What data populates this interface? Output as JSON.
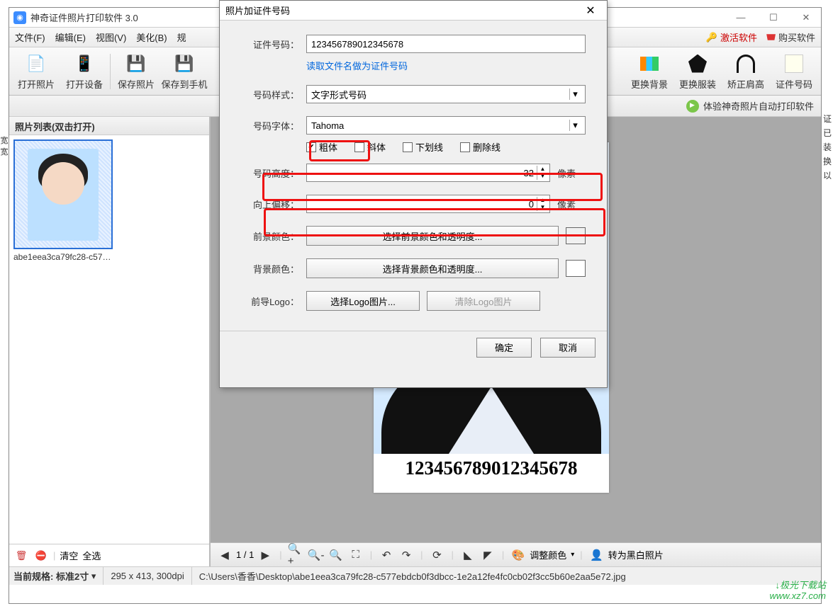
{
  "app": {
    "title": "神奇证件照片打印软件 3.0",
    "win_min": "—",
    "win_max": "☐",
    "win_close": "✕"
  },
  "menu": {
    "file": "文件(F)",
    "edit": "编辑(E)",
    "view": "视图(V)",
    "beautify": "美化(B)",
    "spec": "规",
    "activate": "激活软件",
    "buy": "购买软件"
  },
  "toolbar": {
    "open_photo": "打开照片",
    "open_device": "打开设备",
    "save_photo": "保存照片",
    "save_phone": "保存到手机",
    "change_bg": "更换背景",
    "change_clothes": "更换服装",
    "fix_shoulder": "矫正肩高",
    "id_number": "证件号码"
  },
  "promo": {
    "text": "体验神奇照片自动打印软件"
  },
  "left": {
    "header": "照片列表(双击打开)",
    "thumb_name": "abe1eea3ca79fc28-c577ebdcb0f...",
    "clear": "清空",
    "select_all": "全选"
  },
  "preview": {
    "caption": "123456789012345678"
  },
  "center_footer": {
    "page": "1 / 1",
    "adjust_color": "调整颜色",
    "to_bw": "转为黑白照片"
  },
  "status": {
    "spec_label": "当前规格:",
    "spec_value": "标准2寸",
    "dims": "295 x 413, 300dpi",
    "path": "C:\\Users\\香香\\Desktop\\abe1eea3ca79fc28-c577ebdcb0f3dbcc-1e2a12fe4fc0cb02f3cc5b60e2aa5e72.jpg"
  },
  "dialog": {
    "title": "照片加证件号码",
    "close": "✕",
    "lbl_id": "证件号码：",
    "val_id": "123456789012345678",
    "link_filename": "读取文件名做为证件号码",
    "lbl_style": "号码样式：",
    "val_style": "文字形式号码",
    "lbl_font": "号码字体：",
    "val_font": "Tahoma",
    "chk_bold": "粗体",
    "chk_italic": "斜体",
    "chk_underline": "下划线",
    "chk_strike": "删除线",
    "lbl_height": "号码高度：",
    "val_height": "32",
    "unit_px": "像素",
    "lbl_offset": "向上偏移：",
    "val_offset": "0",
    "lbl_fg": "前景颜色：",
    "btn_fg": "选择前景颜色和透明度...",
    "lbl_bg": "背景颜色：",
    "btn_bg": "选择背景颜色和透明度...",
    "lbl_logo": "前导Logo：",
    "btn_logo_sel": "选择Logo图片...",
    "btn_logo_clr": "清除Logo图片",
    "ok": "确定",
    "cancel": "取消",
    "colors": {
      "fg": "#000000",
      "bg": "#ffffff"
    }
  },
  "watermark": {
    "l1": "↓极光下载站",
    "l2": "www.xz7.com"
  },
  "side_text": {
    "right": "证已装换以",
    "left": "宽 宽"
  }
}
